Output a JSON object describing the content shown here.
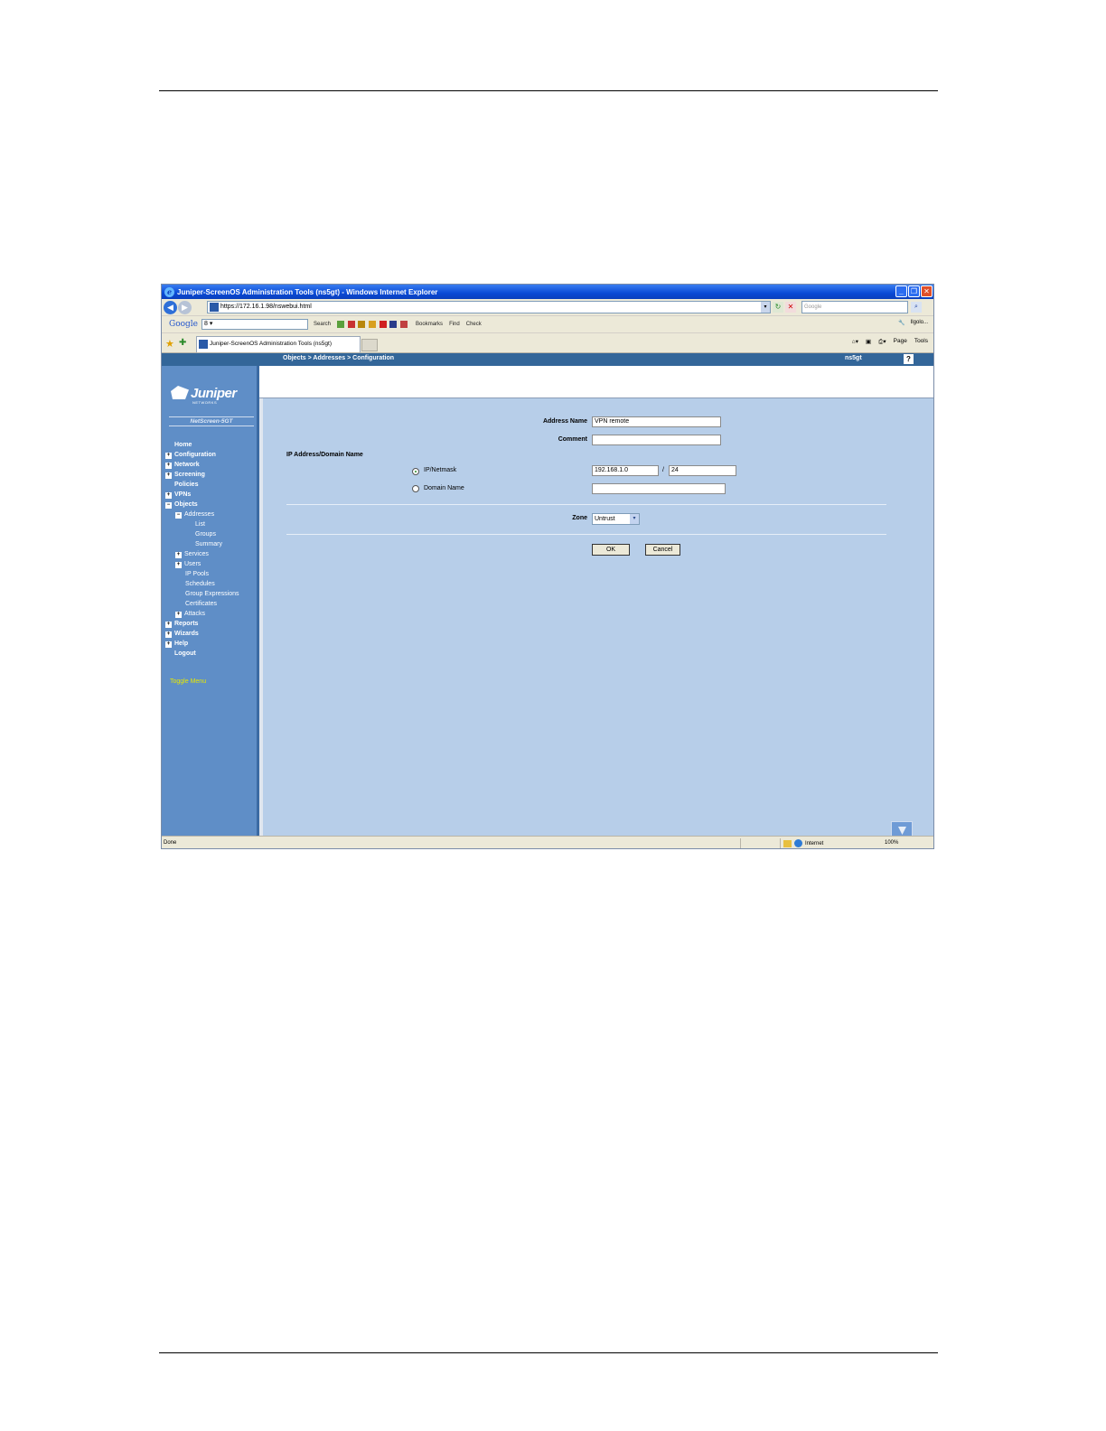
{
  "browser": {
    "title": "Juniper-ScreenOS Administration Tools (ns5gt) - Windows Internet Explorer",
    "url": "https://172.16.1.98/nswebui.html",
    "search_placeholder": "Google",
    "tab_label": "Juniper-ScreenOS Administration Tools (ns5gt)",
    "status": "Done",
    "zone": "Internet",
    "zoom": "100%"
  },
  "google_toolbar": {
    "logo": "Google",
    "box": "8 ▾",
    "search": "Search",
    "bookmarks": "Bookmarks",
    "find": "Find",
    "check": "Check",
    "right_label": "Ilgolo..."
  },
  "command_bar": {
    "page": "Page",
    "tools": "Tools"
  },
  "topnav": {
    "breadcrumb": "Objects > Addresses > Configuration",
    "device": "ns5gt",
    "help": "?"
  },
  "sidebar": {
    "brand": "Juniper",
    "brand_sub": "NETWORKS",
    "model": "NetScreen-5GT",
    "toggle_menu": "Toggle Menu",
    "items": [
      {
        "label": "Home",
        "pm": ""
      },
      {
        "label": "Configuration",
        "pm": "+"
      },
      {
        "label": "Network",
        "pm": "+"
      },
      {
        "label": "Screening",
        "pm": "+"
      },
      {
        "label": "Policies",
        "pm": ""
      },
      {
        "label": "VPNs",
        "pm": "+"
      },
      {
        "label": "Objects",
        "pm": "−"
      },
      {
        "label": "Addresses",
        "pm": "−"
      },
      {
        "label": "List",
        "pm": ""
      },
      {
        "label": "Groups",
        "pm": ""
      },
      {
        "label": "Summary",
        "pm": ""
      },
      {
        "label": "Services",
        "pm": "+"
      },
      {
        "label": "Users",
        "pm": "+"
      },
      {
        "label": "IP Pools",
        "pm": ""
      },
      {
        "label": "Schedules",
        "pm": ""
      },
      {
        "label": "Group Expressions",
        "pm": ""
      },
      {
        "label": "Certificates",
        "pm": ""
      },
      {
        "label": "Attacks",
        "pm": "+"
      },
      {
        "label": "Reports",
        "pm": "+"
      },
      {
        "label": "Wizards",
        "pm": "+"
      },
      {
        "label": "Help",
        "pm": "+"
      },
      {
        "label": "Logout",
        "pm": ""
      }
    ]
  },
  "form": {
    "address_name_label": "Address Name",
    "address_name_value": "VPN remote",
    "comment_label": "Comment",
    "comment_value": "",
    "section_label": "IP Address/Domain Name",
    "ip_netmask_label": "IP/Netmask",
    "ip_value": "192.168.1.0",
    "slash": "/",
    "mask_value": "24",
    "domain_name_label": "Domain Name",
    "domain_value": "",
    "zone_label": "Zone",
    "zone_value": "Untrust",
    "ok": "OK",
    "cancel": "Cancel"
  }
}
